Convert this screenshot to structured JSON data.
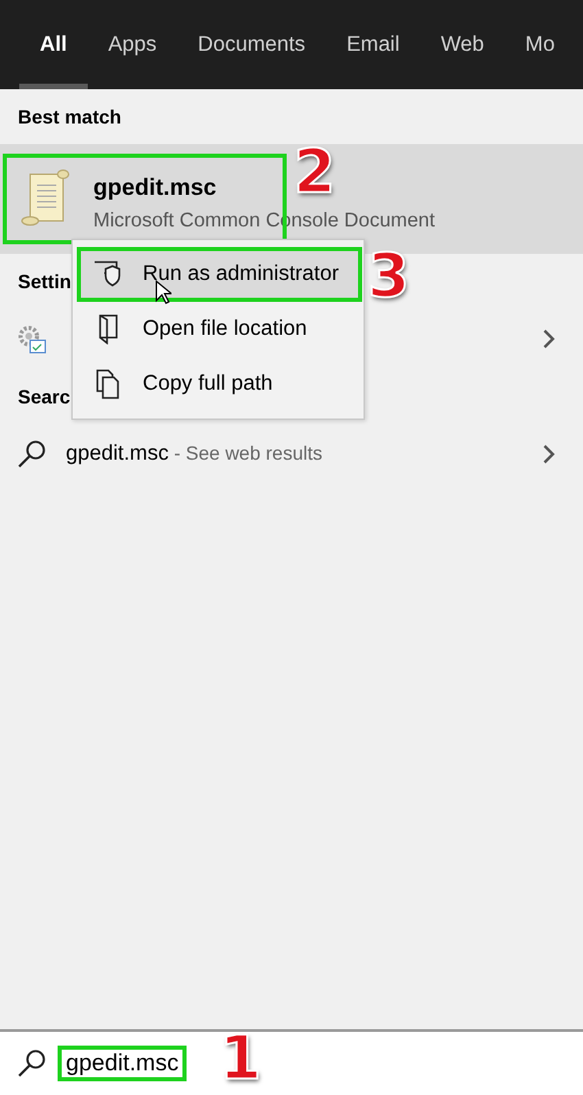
{
  "tabs": [
    {
      "label": "All",
      "selected": true
    },
    {
      "label": "Apps",
      "selected": false
    },
    {
      "label": "Documents",
      "selected": false
    },
    {
      "label": "Email",
      "selected": false
    },
    {
      "label": "Web",
      "selected": false
    },
    {
      "label": "Mo",
      "selected": false
    }
  ],
  "best_match": {
    "heading": "Best match",
    "title": "gpedit.msc",
    "subtitle": "Microsoft Common Console Document",
    "callout": "2"
  },
  "settings": {
    "heading": "Settin"
  },
  "search_web": {
    "heading": "Searc",
    "query": "gpedit.msc",
    "suffix": " - See web results"
  },
  "context_menu": [
    {
      "kind": "admin",
      "label": "Run as administrator",
      "selected": true,
      "callout": "3"
    },
    {
      "kind": "folder",
      "label": "Open file location",
      "selected": false
    },
    {
      "kind": "copy",
      "label": "Copy full path",
      "selected": false
    }
  ],
  "search_box": {
    "value": "gpedit.msc",
    "callout": "1"
  }
}
